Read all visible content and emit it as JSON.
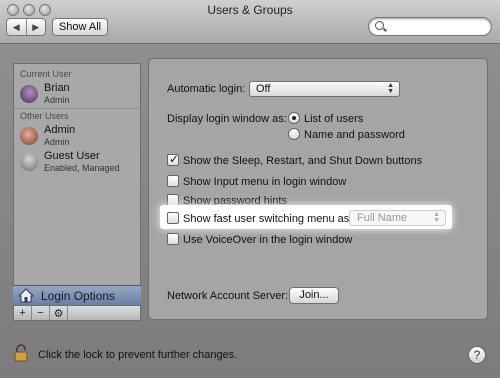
{
  "window": {
    "title": "Users & Groups"
  },
  "toolbar": {
    "back_label": "◀",
    "forward_label": "▶",
    "show_all_label": "Show All",
    "search_placeholder": ""
  },
  "sidebar": {
    "current_user_header": "Current User",
    "current_user": {
      "name": "Brian",
      "role": "Admin"
    },
    "other_users_header": "Other Users",
    "other_users": [
      {
        "name": "Admin",
        "role": "Admin"
      },
      {
        "name": "Guest User",
        "role": "Enabled, Managed"
      }
    ],
    "login_options_label": "Login Options",
    "add_label": "+",
    "remove_label": "−",
    "gear_label": "⚙"
  },
  "panel": {
    "automatic_login_label": "Automatic login:",
    "automatic_login_value": "Off",
    "display_window_label": "Display login window as:",
    "display_options": [
      "List of users",
      "Name and password"
    ],
    "display_selected": "List of users",
    "checkboxes": [
      {
        "label": "Show the Sleep, Restart, and Shut Down buttons",
        "checked": true
      },
      {
        "label": "Show Input menu in login window",
        "checked": false
      },
      {
        "label": "Show password hints",
        "checked": false
      },
      {
        "label": "Show fast user switching menu as",
        "checked": false
      },
      {
        "label": "Use VoiceOver in the login window",
        "checked": false
      }
    ],
    "fast_switch_menu_value": "Full Name",
    "network_server_label": "Network Account Server:",
    "join_label": "Join..."
  },
  "footer": {
    "lock_text": "Click the lock to prevent further changes.",
    "help_label": "?"
  }
}
